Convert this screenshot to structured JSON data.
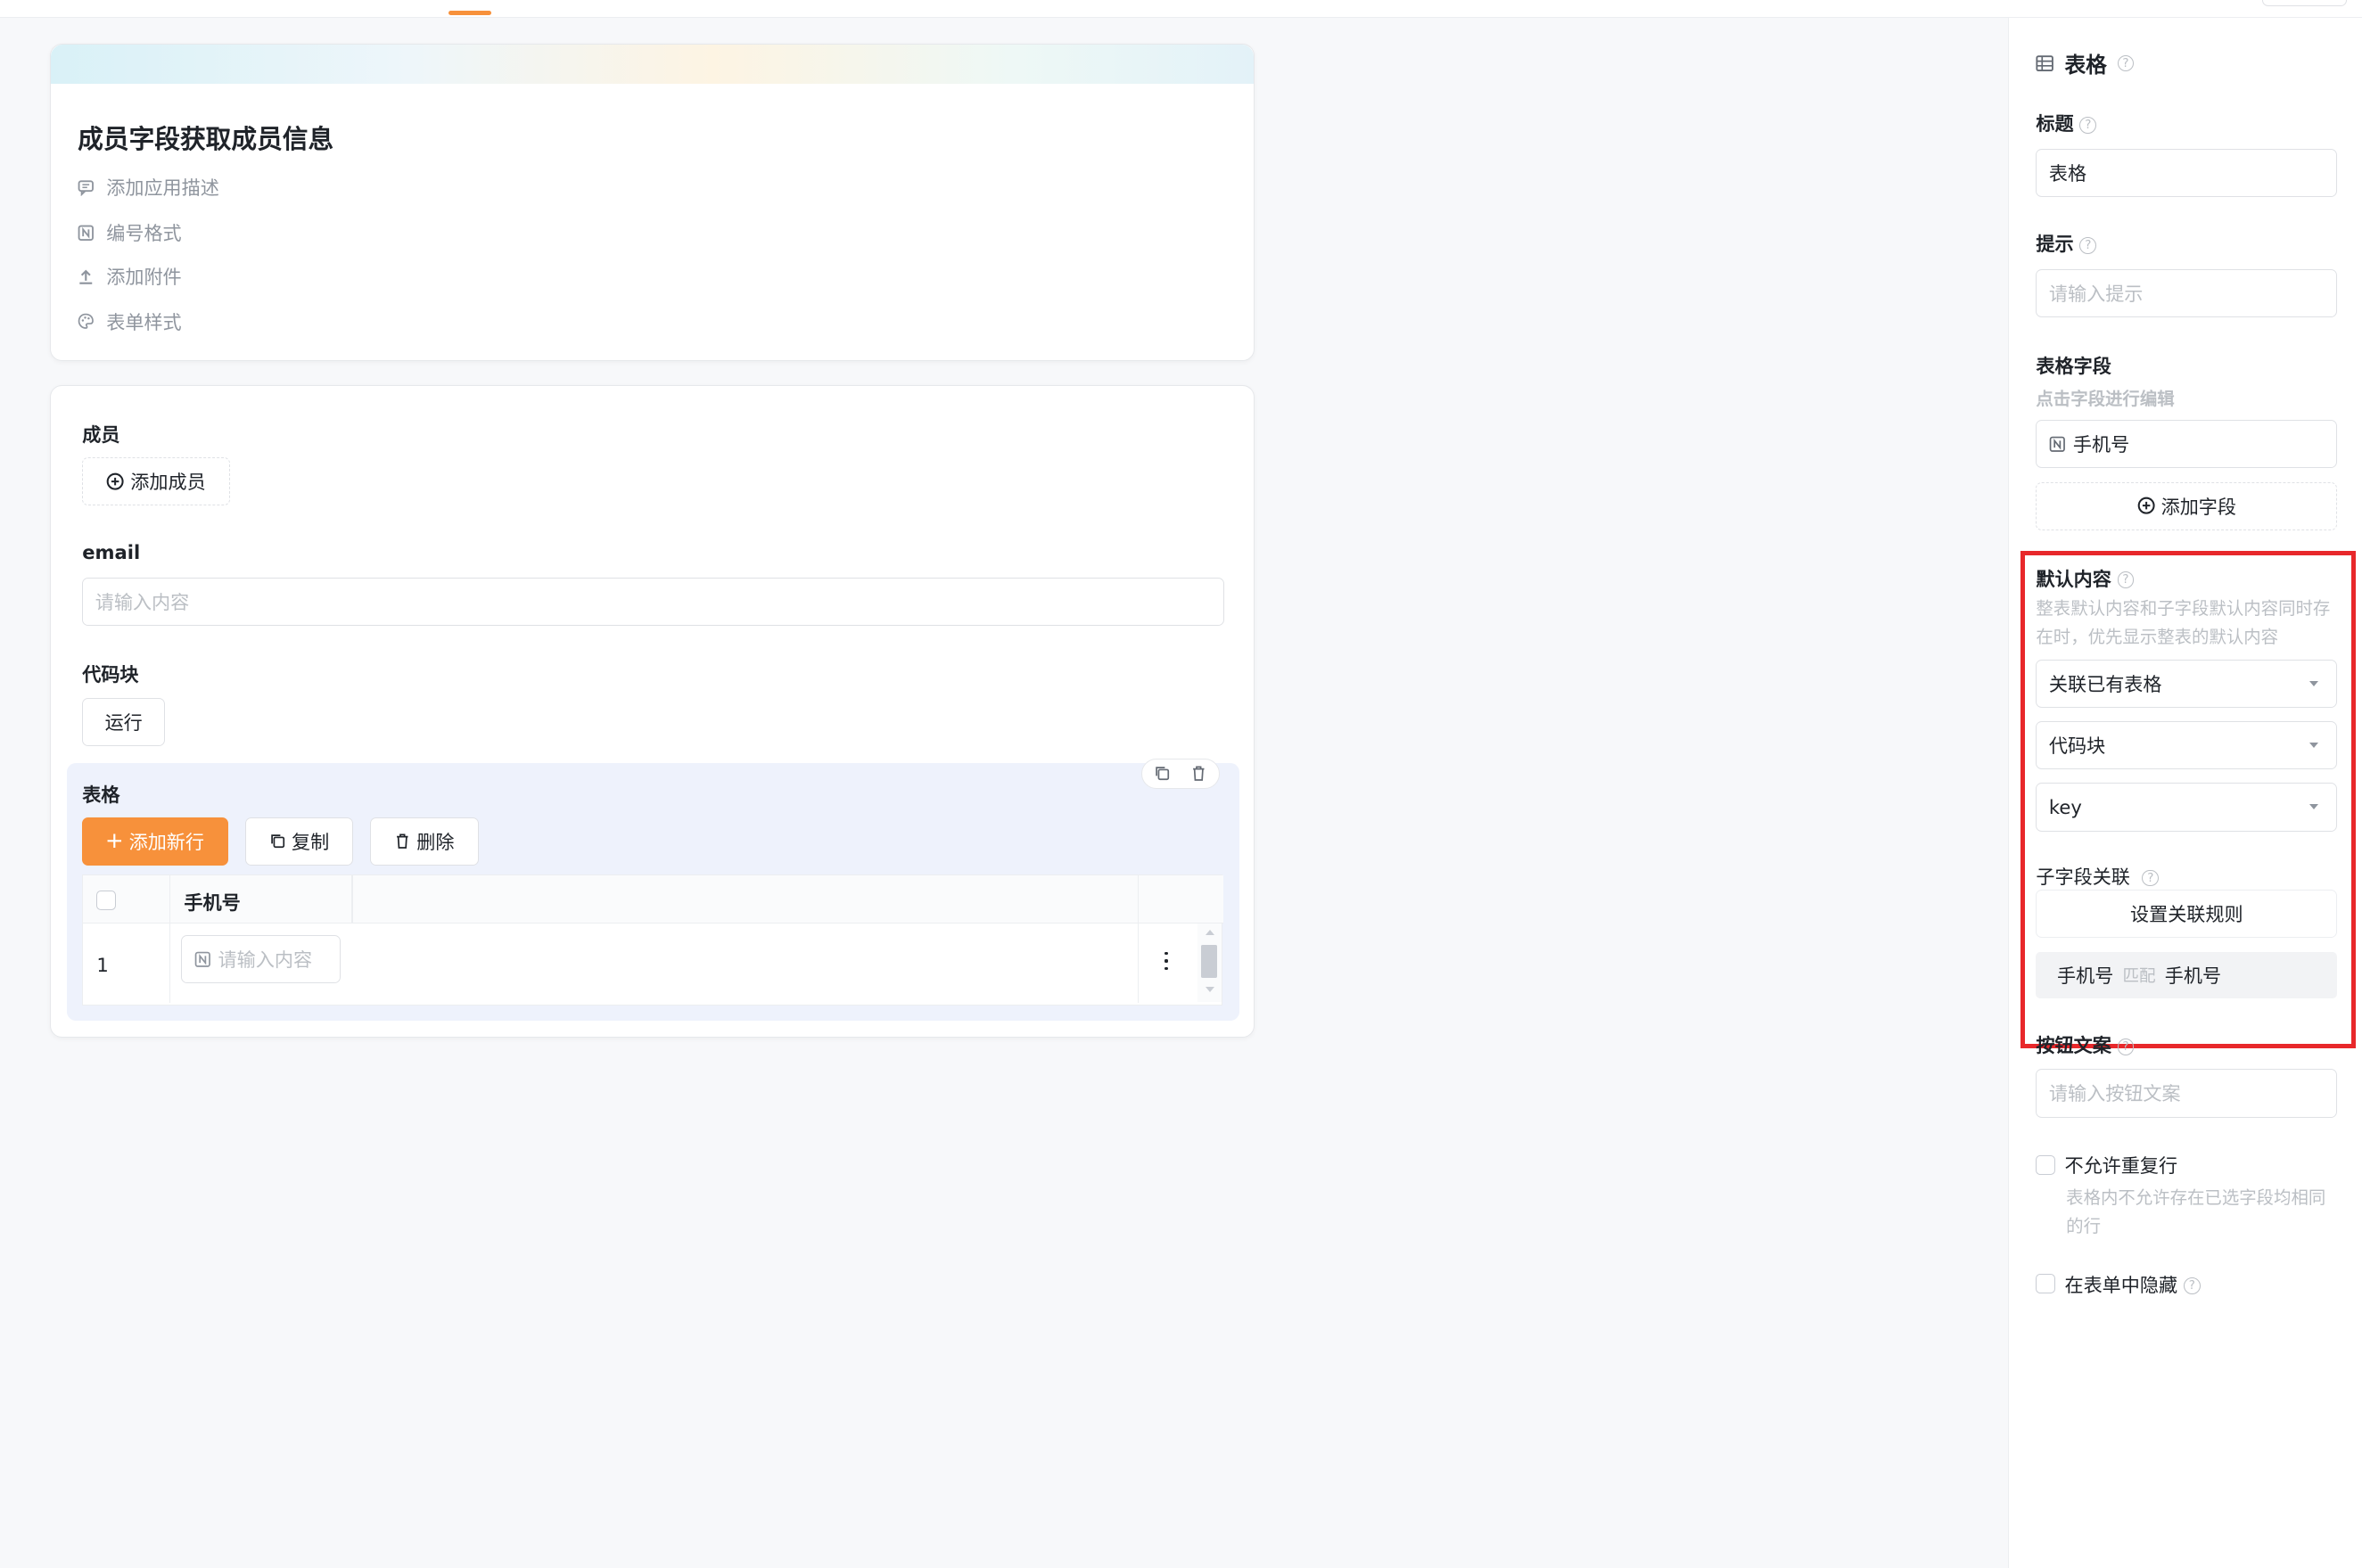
{
  "form": {
    "title": "成员字段获取成员信息",
    "meta": {
      "description": "添加应用描述",
      "numbering": "编号格式",
      "attachment": "添加附件",
      "style": "表单样式"
    }
  },
  "fields": {
    "member": {
      "label": "成员",
      "button": "添加成员"
    },
    "email": {
      "label": "email",
      "placeholder": "请输入内容"
    },
    "code_block": {
      "label": "代码块",
      "button": "运行"
    },
    "table": {
      "label": "表格",
      "add_row": "添加新行",
      "copy": "复制",
      "delete": "删除",
      "columns": [
        "手机号"
      ],
      "rows": [
        {
          "index": "1",
          "placeholder": "请输入内容"
        }
      ]
    }
  },
  "panel": {
    "header": "表格",
    "title": {
      "label": "标题",
      "value": "表格"
    },
    "hint": {
      "label": "提示",
      "placeholder": "请输入提示"
    },
    "table_fields": {
      "label": "表格字段",
      "sub": "点击字段进行编辑",
      "items": [
        "手机号"
      ],
      "add": "添加字段"
    },
    "default_content": {
      "label": "默认内容",
      "desc_line1": "整表默认内容和子字段默认内容同时存",
      "desc_line2": "在时，优先显示整表的默认内容",
      "select1": "关联已有表格",
      "select2": "代码块",
      "select3": "key",
      "sub_link": "子字段关联",
      "rule_button": "设置关联规则",
      "match_left": "手机号",
      "match_tag": "匹配",
      "match_right": "手机号"
    },
    "button_text": {
      "label": "按钮文案",
      "placeholder": "请输入按钮文案"
    },
    "no_dup": {
      "label": "不允许重复行",
      "desc_line1": "表格内不允许存在已选字段均相同",
      "desc_line2": "的行"
    },
    "hide": {
      "label": "在表单中隐藏"
    }
  },
  "colors": {
    "accent": "#f7913b",
    "highlight": "#e8282b",
    "table_bg": "#eef2fc"
  }
}
